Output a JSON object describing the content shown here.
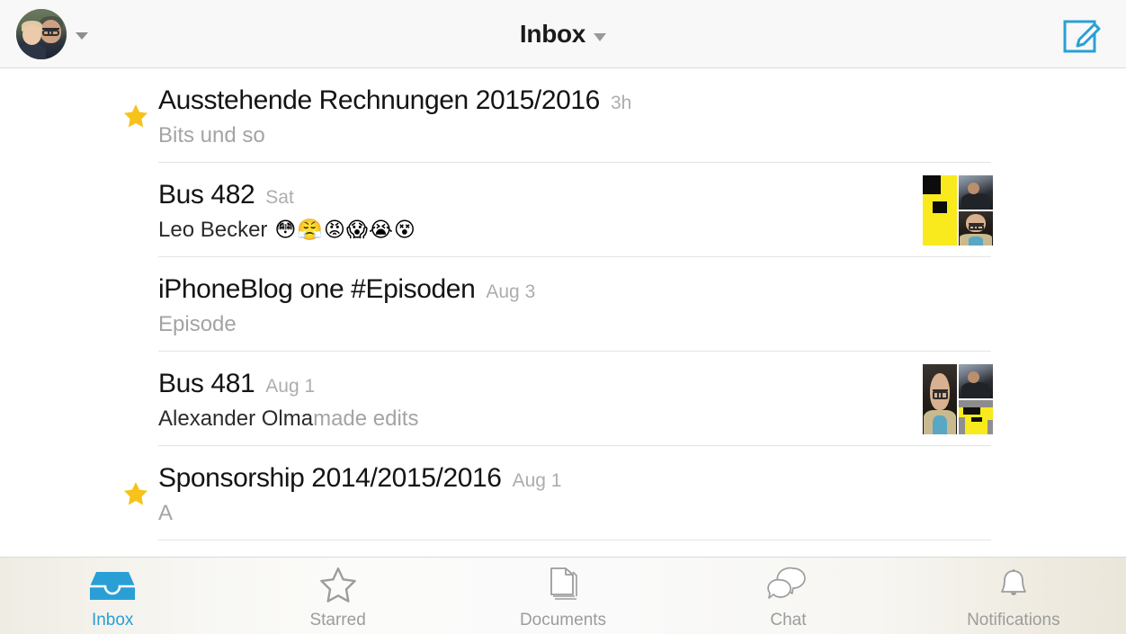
{
  "header": {
    "title": "Inbox",
    "avatar_name": "user-avatar",
    "account_chevron": "chevron-down-icon",
    "compose_label": "compose-icon"
  },
  "colors": {
    "accent_blue": "#2a9fd6",
    "star_gold": "#f7c31b",
    "title_text": "#141414",
    "muted_text": "#a4a4a4",
    "divider": "#e4e4e4",
    "header_bg": "#f8f8f8",
    "logo_yellow": "#f8ea1c"
  },
  "list": [
    {
      "title": "Ausstehende Rechnungen 2015/2016",
      "time": "3h",
      "snippet_strong": "",
      "snippet_muted": "Bits und so",
      "emoji": "",
      "starred": true,
      "thumbs": "none"
    },
    {
      "title": "Bus 482",
      "time": "Sat",
      "snippet_strong": "Leo Becker",
      "snippet_muted": "",
      "emoji": "😳😤😡😱😭😵",
      "starred": false,
      "thumbs": "logo-crowd-bald"
    },
    {
      "title": "iPhoneBlog one #Episoden",
      "time": "Aug 3",
      "snippet_strong": "",
      "snippet_muted": "Episode",
      "emoji": "",
      "starred": false,
      "thumbs": "none"
    },
    {
      "title": "Bus 481",
      "time": "Aug 1",
      "snippet_strong": "Alexander Olma",
      "snippet_muted": " made edits",
      "emoji": "",
      "starred": false,
      "thumbs": "bald-crowd-logo"
    },
    {
      "title": "Sponsorship 2014/2015/2016",
      "time": "Aug 1",
      "snippet_strong": "",
      "snippet_muted": "A",
      "emoji": "",
      "starred": true,
      "thumbs": "none"
    }
  ],
  "tabs": [
    {
      "label": "Inbox",
      "icon": "inbox-icon",
      "active": true
    },
    {
      "label": "Starred",
      "icon": "star-outline-icon",
      "active": false
    },
    {
      "label": "Documents",
      "icon": "documents-icon",
      "active": false
    },
    {
      "label": "Chat",
      "icon": "chat-bubbles-icon",
      "active": false
    },
    {
      "label": "Notifications",
      "icon": "bell-icon",
      "active": false
    }
  ]
}
